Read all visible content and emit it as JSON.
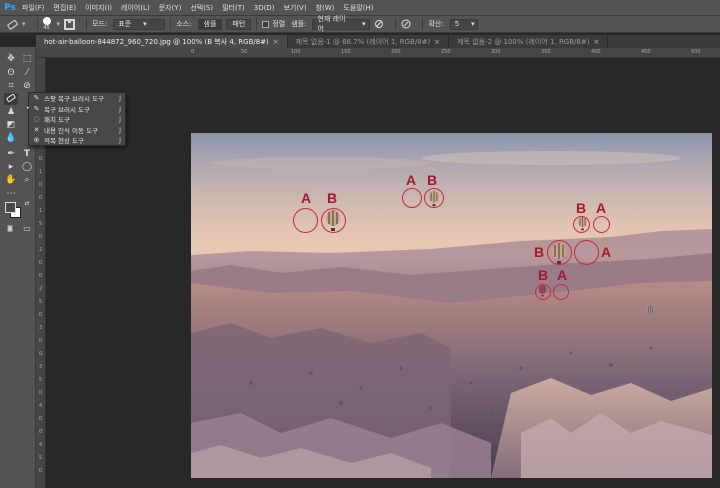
{
  "app": {
    "logo": "Ps"
  },
  "menu": [
    "파일(F)",
    "편집(E)",
    "이미지(I)",
    "레이어(L)",
    "문자(Y)",
    "선택(S)",
    "필터(T)",
    "3D(D)",
    "보기(V)",
    "창(W)",
    "도움말(H)"
  ],
  "options": {
    "brush_size": "45",
    "mode_label": "모드:",
    "mode_value": "표준",
    "source_label": "소스:",
    "source_sampled": "샘플",
    "source_pattern": "패턴",
    "aligned_label": "정렬",
    "sample_label": "샘플:",
    "sample_value": "현재 레이어",
    "diffusion_label": "확산:",
    "diffusion_value": "5"
  },
  "tabs": [
    {
      "label": "hot-air-balloon-844872_960_720.jpg @ 100% (B 복사 4, RGB/8#)",
      "close": "×",
      "active": true
    },
    {
      "label": "제목 없음-1 @ 66.7% (레이어 1, RGB/8#)",
      "close": "×",
      "active": false
    },
    {
      "label": "제목 없음-2 @ 100% (레이어 1, RGB/8#)",
      "close": "×",
      "active": false
    }
  ],
  "rulers": {
    "top": [
      "0",
      "50",
      "100",
      "150",
      "200",
      "250",
      "300",
      "350",
      "400",
      "450",
      "500",
      "550",
      "600",
      "650"
    ],
    "left": [
      "0",
      "5",
      "0",
      "1",
      "0",
      "0",
      "1",
      "5",
      "0",
      "2",
      "0",
      "0",
      "2",
      "5",
      "0",
      "3",
      "0",
      "0",
      "3",
      "5",
      "0",
      "4",
      "0",
      "0",
      "4",
      "5",
      "0"
    ]
  },
  "flyout": [
    {
      "label": "스팟 복구 브러시 도구",
      "key": "J",
      "selected": false,
      "icon": "spot-healing-icon"
    },
    {
      "label": "복구 브러시 도구",
      "key": "J",
      "selected": true,
      "icon": "healing-brush-icon"
    },
    {
      "label": "패치 도구",
      "key": "J",
      "selected": false,
      "icon": "patch-icon"
    },
    {
      "label": "내용 인식 이동 도구",
      "key": "J",
      "selected": false,
      "icon": "content-aware-move-icon"
    },
    {
      "label": "적목 현상 도구",
      "key": "J",
      "selected": false,
      "icon": "red-eye-icon"
    }
  ],
  "markers": {
    "a": "A",
    "b": "B"
  },
  "colors": {
    "marker": "#a11b2d",
    "ring": "#c42b3e",
    "chrome": "#535353",
    "workspace": "#282828"
  }
}
